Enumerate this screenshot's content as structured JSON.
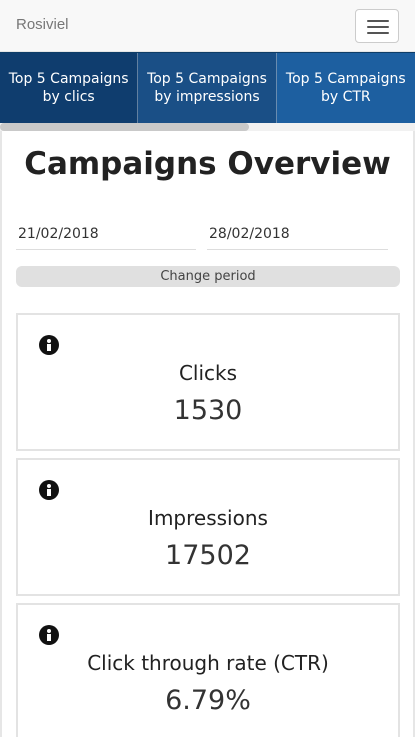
{
  "app": {
    "brand": "Rosiviel"
  },
  "tabs": [
    {
      "label": "Top 5 Campaigns by clics"
    },
    {
      "label": "Top 5 Campaigns by impressions"
    },
    {
      "label": "Top 5 Campaigns by CTR"
    }
  ],
  "scroll": {
    "thumb_fraction": 0.6
  },
  "page": {
    "title": "Campaigns Overview"
  },
  "period": {
    "start": "21/02/2018",
    "end": "28/02/2018",
    "change_label": "Change period"
  },
  "cards": [
    {
      "label": "Clicks",
      "value": "1530",
      "icon": "info-icon"
    },
    {
      "label": "Impressions",
      "value": "17502",
      "icon": "info-icon"
    },
    {
      "label": "Click through rate (CTR)",
      "value": "6.79%",
      "icon": "info-icon"
    }
  ],
  "colors": {
    "tab1": "#0f3d6e",
    "tab2": "#1a4f86",
    "tab3": "#1d5fa0"
  }
}
